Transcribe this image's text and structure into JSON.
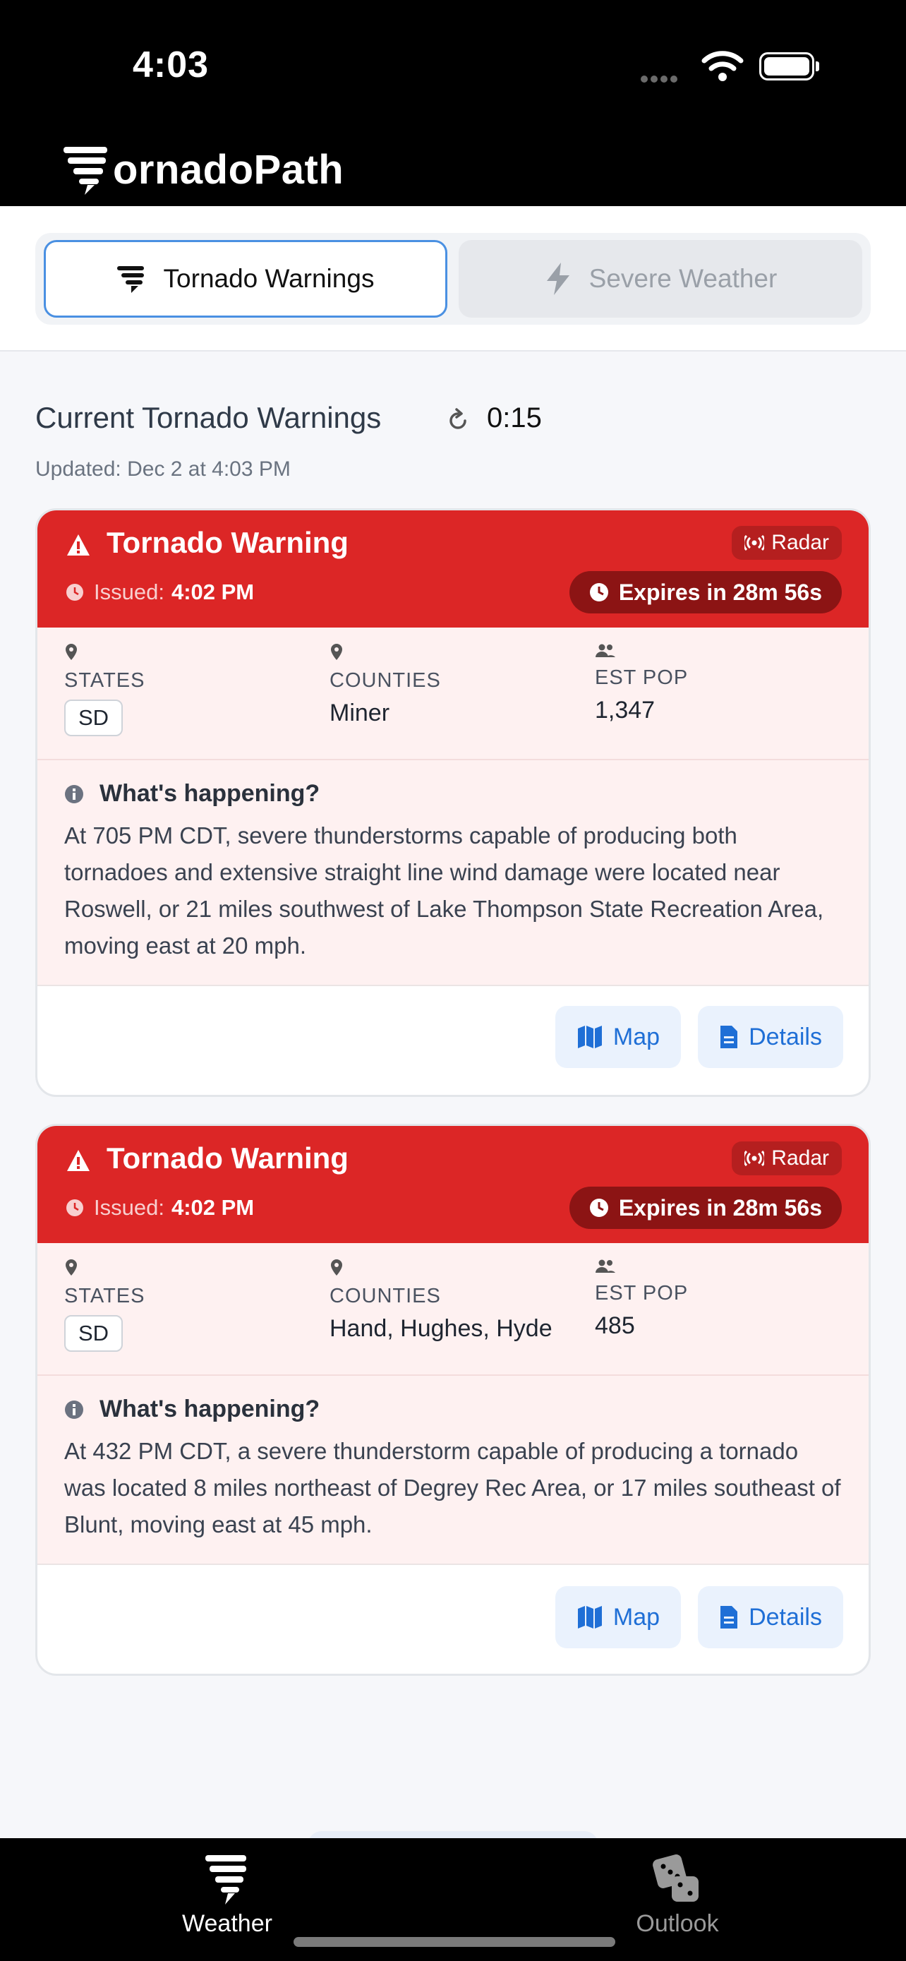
{
  "status_bar": {
    "time": "4:03"
  },
  "app": {
    "brand_name": "ornadoPath"
  },
  "tabs": [
    {
      "label": "Tornado Warnings",
      "active": true
    },
    {
      "label": "Severe Weather",
      "active": false
    }
  ],
  "section": {
    "title": "Current Tornado Warnings",
    "countdown": "0:15",
    "updated": "Updated: Dec 2 at 4:03 PM"
  },
  "labels": {
    "states": "STATES",
    "counties": "COUNTIES",
    "est_pop": "EST POP",
    "whats_happening": "What's happening?",
    "radar": "Radar",
    "issued": "Issued:",
    "map": "Map",
    "details": "Details"
  },
  "warnings": [
    {
      "title": "Tornado Warning",
      "issued_time": "4:02 PM",
      "expires": "Expires in 28m 56s",
      "state": "SD",
      "counties": "Miner",
      "est_pop": "1,347",
      "description": "At 705 PM CDT, severe thunderstorms capable of producing both tornadoes and extensive straight line wind damage were located near Roswell, or 21 miles southwest of Lake Thompson State Recreation Area, moving east at 20 mph."
    },
    {
      "title": "Tornado Warning",
      "issued_time": "4:02 PM",
      "expires": "Expires in 28m 56s",
      "state": "SD",
      "counties": "Hand, Hughes, Hyde",
      "est_pop": "485",
      "description": "At 432 PM CDT, a severe thunderstorm capable of producing a tornado was located 8 miles northeast of Degrey Rec Area, or 17 miles southeast of Blunt, moving east at 45 mph."
    }
  ],
  "tab_bar": [
    {
      "label": "Weather",
      "active": true
    },
    {
      "label": "Outlook",
      "active": false
    }
  ],
  "colors": {
    "warning_red": "#dc2626",
    "expires_pill": "#8c1414",
    "accent_blue": "#1f6fd6",
    "card_tint": "#fef1f1"
  }
}
